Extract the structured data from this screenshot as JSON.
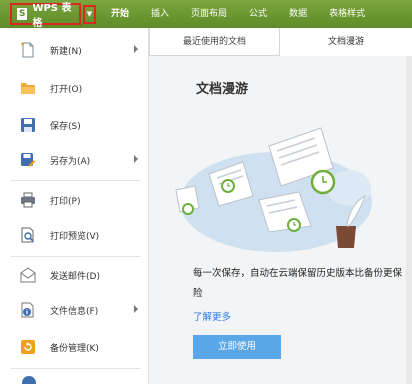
{
  "app": {
    "name": "WPS 表格",
    "logo_letter": "S"
  },
  "ribbon": {
    "tabs": [
      "开始",
      "插入",
      "页面布局",
      "公式",
      "数据",
      "表格样式"
    ]
  },
  "menu": {
    "items": [
      {
        "label": "新建(N)",
        "has_submenu": true,
        "icon": "new-doc-icon"
      },
      {
        "label": "打开(O)",
        "has_submenu": false,
        "icon": "open-folder-icon"
      },
      {
        "label": "保存(S)",
        "has_submenu": false,
        "icon": "save-icon"
      },
      {
        "label": "另存为(A)",
        "has_submenu": true,
        "icon": "save-as-icon"
      },
      {
        "label": "打印(P)",
        "has_submenu": false,
        "icon": "print-icon"
      },
      {
        "label": "打印预览(V)",
        "has_submenu": false,
        "icon": "print-preview-icon"
      },
      {
        "label": "发送邮件(D)",
        "has_submenu": false,
        "icon": "mail-icon"
      },
      {
        "label": "文件信息(F)",
        "has_submenu": true,
        "icon": "file-info-icon"
      },
      {
        "label": "备份管理(K)",
        "has_submenu": false,
        "icon": "backup-icon"
      }
    ]
  },
  "pane": {
    "tabs": {
      "recent": "最近使用的文档",
      "roaming": "文档漫游"
    },
    "title": "文档漫游",
    "description": "每一次保存，自动在云端保留历史版本比备份更保险",
    "learn_more": "了解更多",
    "use_button": "立即使用"
  },
  "colors": {
    "ribbon": "#6b9a31",
    "highlight": "#d62a20",
    "accent_blue": "#5aa7e8",
    "link": "#2b7be4"
  }
}
